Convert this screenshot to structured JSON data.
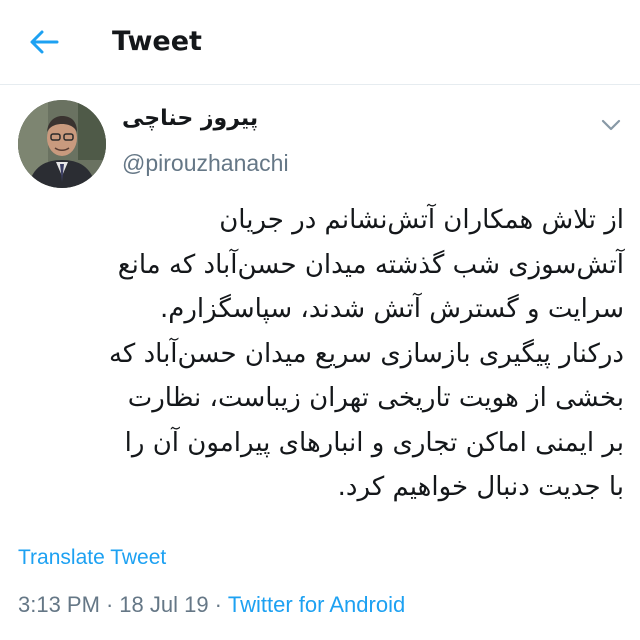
{
  "header": {
    "title": "Tweet",
    "back_icon": "arrow-left-icon",
    "accent_color": "#1da1f2"
  },
  "tweet": {
    "author": {
      "display_name": "پیروز حناچی",
      "handle": "@pirouzhanachi",
      "avatar_icon": "profile-photo"
    },
    "menu_icon": "chevron-down-icon",
    "lines": [
      "از تلاش همکاران آتش‌نشانم در جریان",
      "آتش‌سوزی شب گذشته میدان حسن‌آباد که مانع",
      "سرایت و گسترش آتش شدند، سپاسگزارم.",
      "درکنار پیگیری بازسازی سریع میدان حسن‌آباد که",
      "بخشی از هویت تاریخی تهران زیباست، نظارت",
      "بر ایمنی اماکن تجاری و انبارهای پیرامون آن را",
      "با جدیت دنبال خواهیم کرد."
    ],
    "translate_label": "Translate Tweet",
    "time": "3:13 PM",
    "separator": "·",
    "date": "18 Jul 19",
    "source": "Twitter for Android"
  }
}
